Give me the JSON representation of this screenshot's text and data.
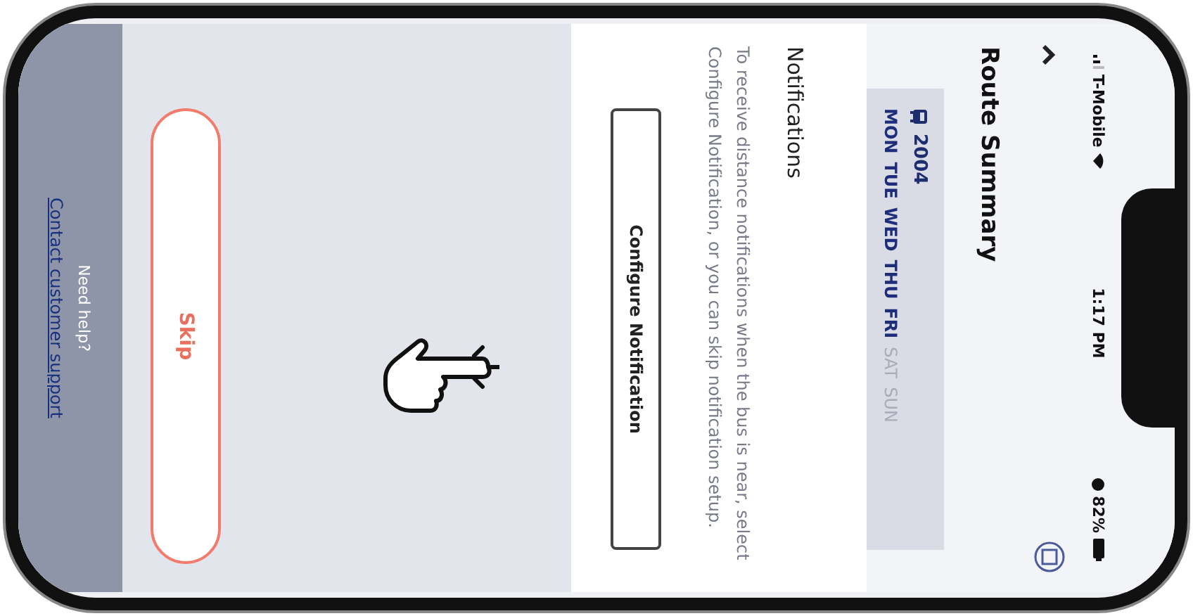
{
  "status_bar": {
    "carrier": "T-Mobile",
    "time": "1:17 PM",
    "battery": "82%"
  },
  "header": {
    "title": "Route Summary"
  },
  "route": {
    "number": "2004",
    "days": [
      {
        "label": "MON",
        "selected": true
      },
      {
        "label": "TUE",
        "selected": true
      },
      {
        "label": "WED",
        "selected": true
      },
      {
        "label": "THU",
        "selected": true
      },
      {
        "label": "FRI",
        "selected": true
      },
      {
        "label": "SAT",
        "selected": false
      },
      {
        "label": "SUN",
        "selected": false
      }
    ]
  },
  "notifications": {
    "title": "Notifications",
    "text": "To receive distance notifications when the bus is near, select Configure Notification, or you can skip notification setup.",
    "button": "Configure Notification"
  },
  "skip_button": "Skip",
  "help": {
    "text": "Need help?",
    "link": "Contact customer support"
  }
}
